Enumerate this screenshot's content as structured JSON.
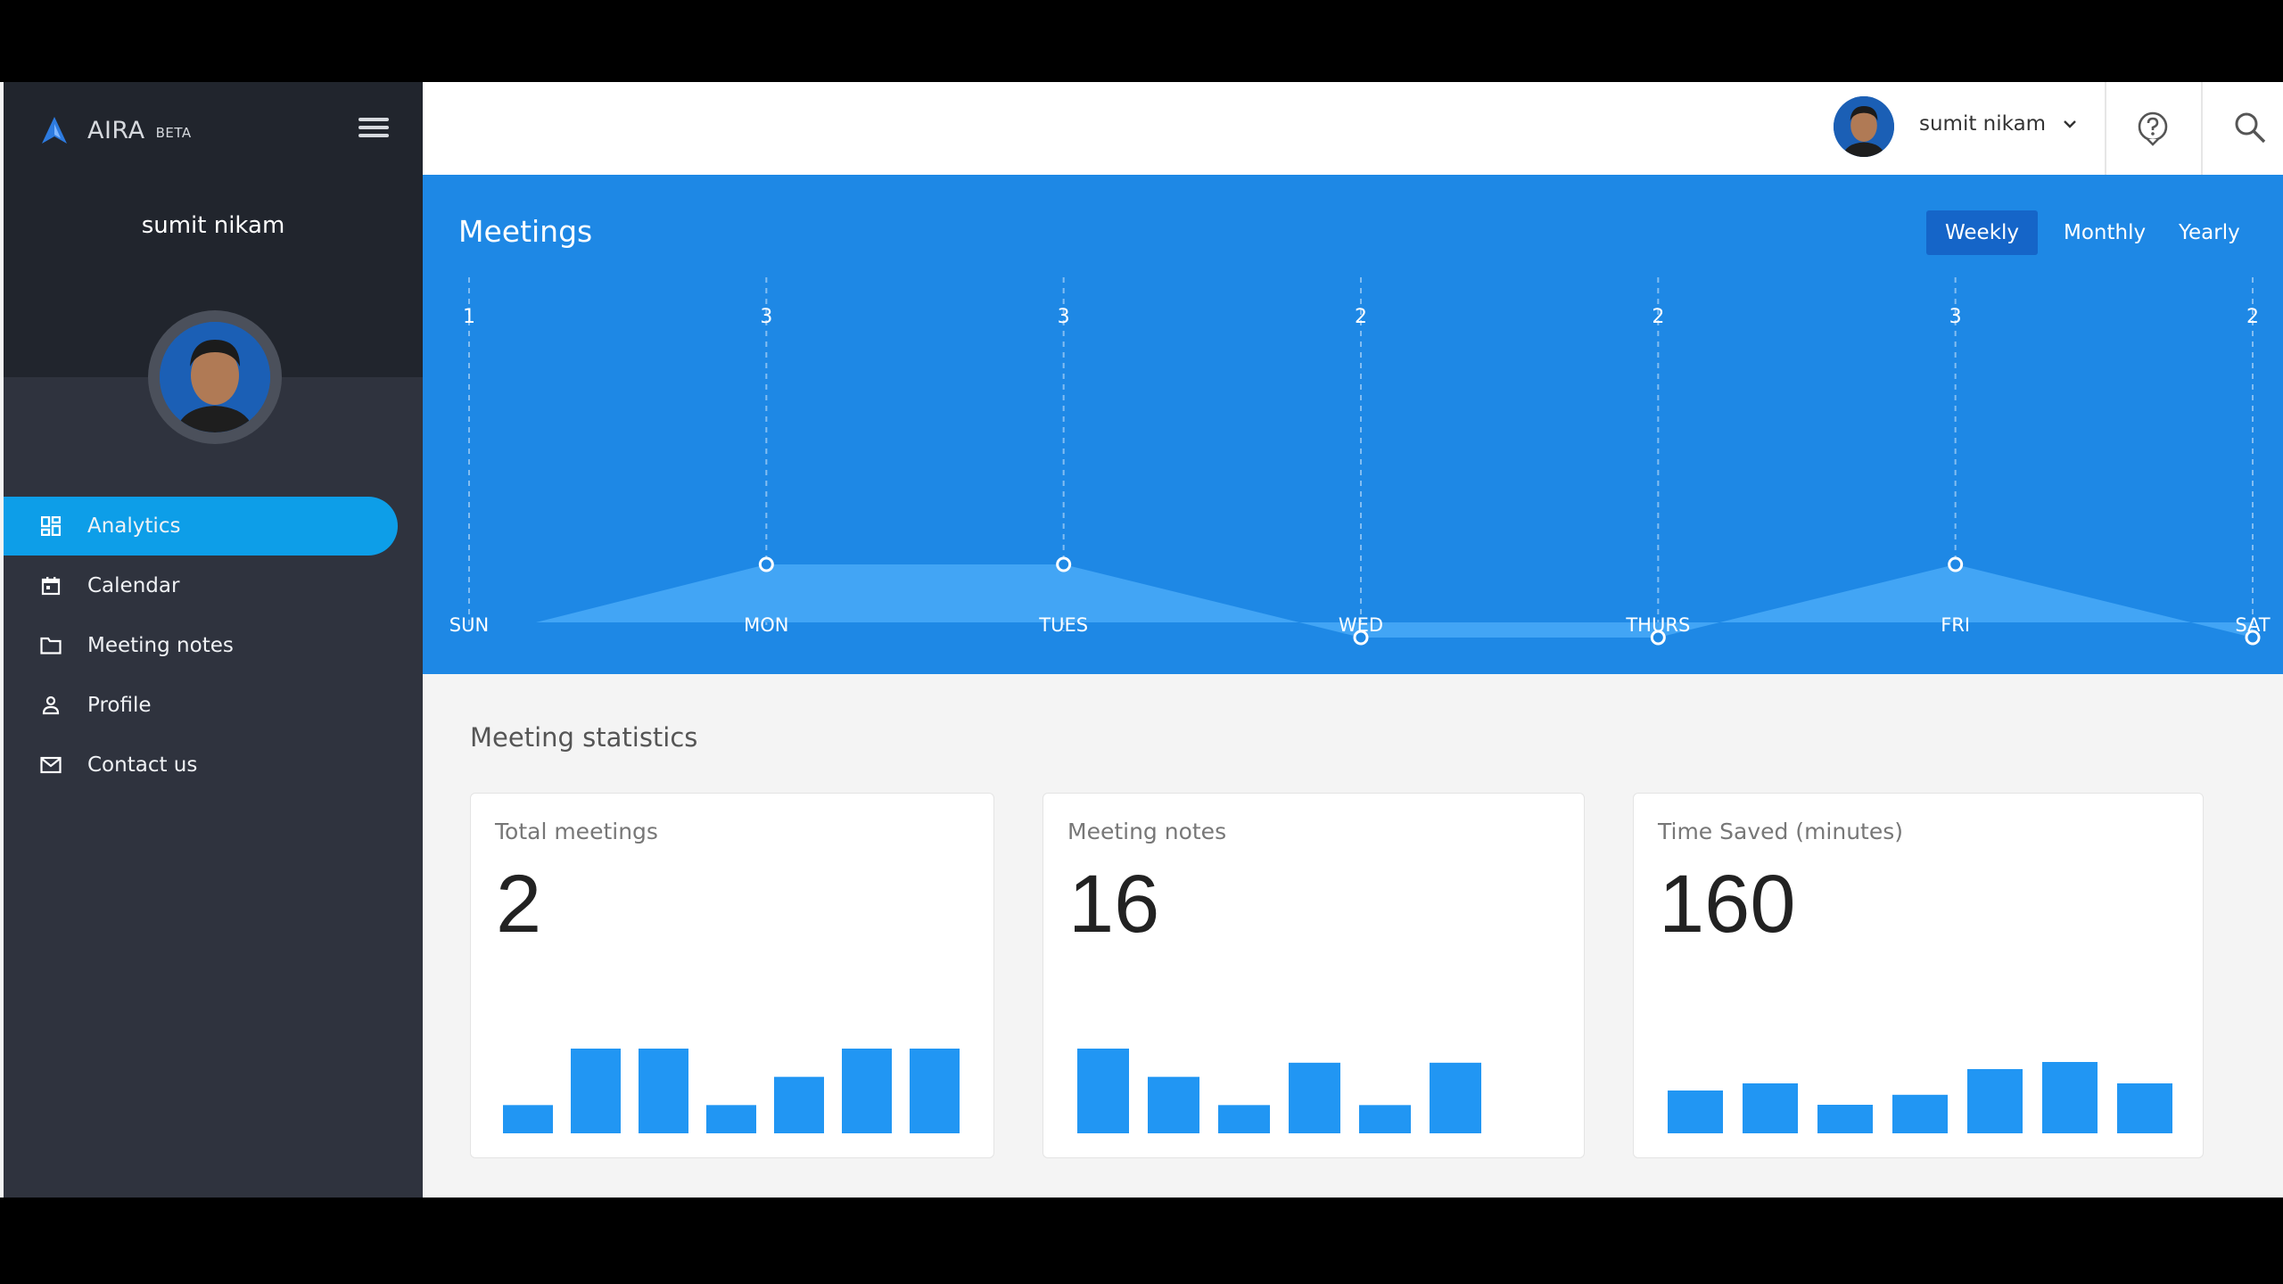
{
  "brand": {
    "name": "AIRA",
    "badge": "BETA"
  },
  "sidebar": {
    "user_name": "sumit nikam",
    "items": [
      {
        "label": "Analytics",
        "icon": "dashboard-icon",
        "active": true
      },
      {
        "label": "Calendar",
        "icon": "calendar-icon",
        "active": false
      },
      {
        "label": "Meeting notes",
        "icon": "folder-icon",
        "active": false
      },
      {
        "label": "Profile",
        "icon": "person-icon",
        "active": false
      },
      {
        "label": "Contact us",
        "icon": "mail-icon",
        "active": false
      }
    ]
  },
  "header": {
    "user_name": "sumit nikam"
  },
  "meetings": {
    "title": "Meetings",
    "periods": [
      "Weekly",
      "Monthly",
      "Yearly"
    ],
    "selected_period": "Weekly"
  },
  "chart_data": {
    "type": "area",
    "categories": [
      "SUN",
      "MON",
      "TUES",
      "WED",
      "THURS",
      "FRI",
      "SAT"
    ],
    "values": [
      1,
      3,
      3,
      2,
      2,
      3,
      2
    ],
    "ylim": [
      0,
      4
    ]
  },
  "statistics": {
    "title": "Meeting statistics",
    "cards": [
      {
        "label": "Total meetings",
        "value": "2",
        "bars": [
          1,
          3,
          3,
          1,
          2,
          3,
          3
        ]
      },
      {
        "label": "Meeting notes",
        "value": "16",
        "bars": [
          6,
          4,
          2,
          5,
          2,
          5
        ]
      },
      {
        "label": "Time Saved (minutes)",
        "value": "160",
        "bars": [
          3,
          3.5,
          2,
          2.7,
          4.5,
          5,
          3.5
        ]
      }
    ]
  },
  "colors": {
    "accent": "#1e88e5",
    "active_nav": "#0d9ee8",
    "sidebar": "#2f333e",
    "bar": "#2196f3"
  }
}
